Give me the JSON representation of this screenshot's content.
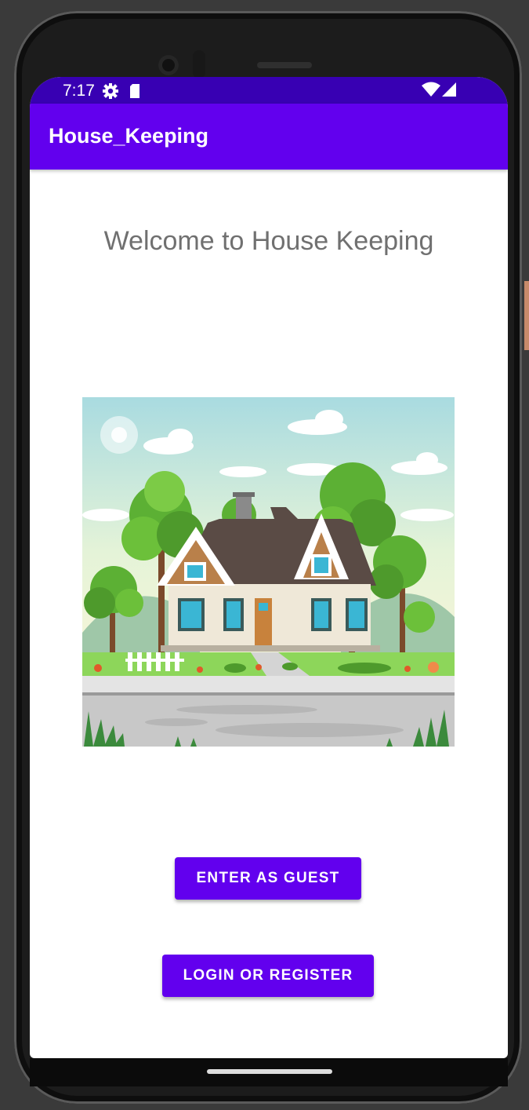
{
  "status_bar": {
    "time": "7:17",
    "icons": [
      "gear-icon",
      "sd-card-icon",
      "wifi-icon",
      "signal-icon"
    ]
  },
  "app_bar": {
    "title": "House_Keeping"
  },
  "main": {
    "welcome_text": "Welcome to House Keeping",
    "image": "house-illustration",
    "buttons": {
      "guest_label": "ENTER AS GUEST",
      "login_label": "LOGIN OR REGISTER"
    }
  },
  "colors": {
    "primary": "#6200ee",
    "status_bar": "#3800b3",
    "welcome_text": "#707070"
  }
}
